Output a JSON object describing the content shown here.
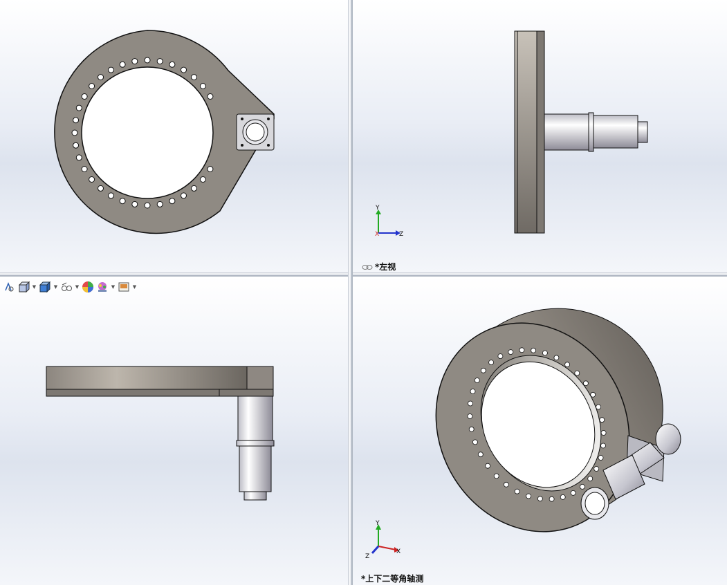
{
  "viewports": {
    "top_left": {
      "label": ""
    },
    "top_right": {
      "label": "*左视"
    },
    "bottom_left": {
      "label": ""
    },
    "bottom_right": {
      "label": "*上下二等角轴测"
    }
  },
  "triad": {
    "x": "X",
    "y": "Y",
    "z": "Z"
  },
  "toolbar": {
    "icons": [
      "zoom-to-fit-icon",
      "view-orientation-icon",
      "display-style-icon",
      "hide-show-icon",
      "edit-appearance-icon",
      "apply-scene-icon",
      "view-settings-icon"
    ]
  },
  "colors": {
    "part_gray": "#8f8a83",
    "triad_x": "#cc2222",
    "triad_y": "#22aa22",
    "triad_z": "#2233cc"
  }
}
